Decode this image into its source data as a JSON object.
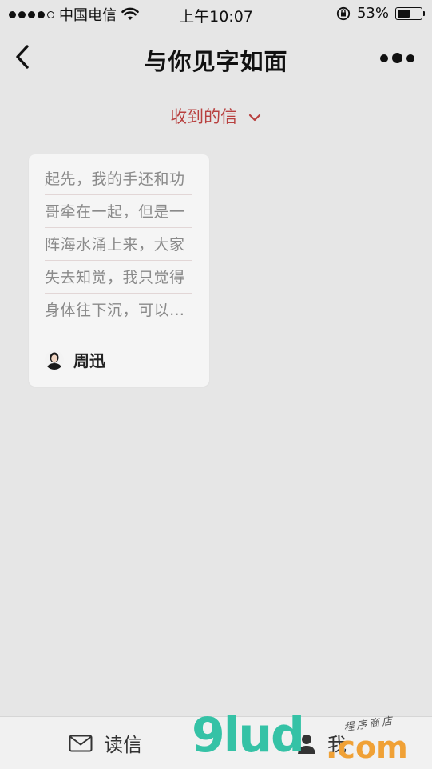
{
  "status_bar": {
    "carrier": "中国电信",
    "time": "上午10:07",
    "battery_percent": "53%",
    "battery_level": 0.53,
    "signal_bars_filled": 4,
    "signal_bars_total": 5,
    "icons": [
      "wifi-icon",
      "orientation-lock-icon",
      "battery-icon"
    ]
  },
  "nav": {
    "title": "与你见字如面",
    "back_icon": "chevron-left-icon",
    "more_icon": "more-dots-icon"
  },
  "filter": {
    "label": "收到的信",
    "icon": "chevron-down-icon",
    "color": "#b8403f"
  },
  "letters": [
    {
      "lines": [
        "起先，我的手还和功",
        "哥牵在一起，但是一",
        "阵海水涌上来，大家",
        "失去知觉，我只觉得",
        "身体往下沉，可以…"
      ],
      "sender": "周迅"
    }
  ],
  "tabbar": {
    "tabs": [
      {
        "label": "读信",
        "icon": "envelope-icon"
      },
      {
        "label": "我",
        "icon": "user-icon"
      }
    ]
  },
  "watermark": {
    "main": "9lud",
    "suffix": ".com",
    "sub": "程序商店"
  }
}
